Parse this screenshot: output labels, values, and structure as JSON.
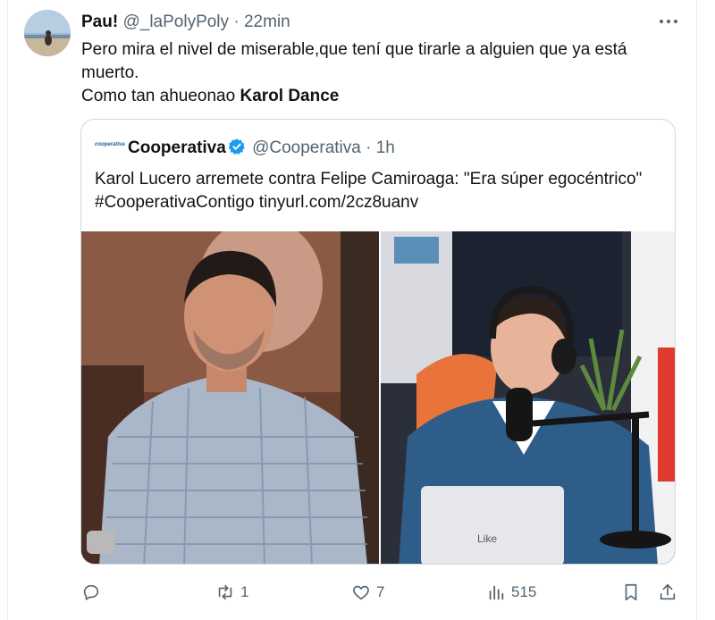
{
  "tweet": {
    "display_name": "Pau!",
    "handle": "@_laPolyPoly",
    "separator": "·",
    "time": "22min",
    "text_line1": "Pero mira el nivel de miserable,que tení que tirarle a alguien que ya está muerto.",
    "text_line2_prefix": "Como tan ahueonao ",
    "text_line2_bold": "Karol Dance"
  },
  "quote": {
    "logo_text": "cooperativa",
    "display_name": "Cooperativa",
    "handle": "@Cooperativa",
    "separator": "·",
    "time": "1h",
    "text_line1": "Karol Lucero arremete contra Felipe Camiroaga: \"Era súper egocéntrico\"",
    "text_line2": "#CooperativaContigo tinyurl.com/2cz8uanv",
    "photo_right_logo": "Like"
  },
  "actions": {
    "reply_count": "",
    "retweet_count": "1",
    "like_count": "7",
    "views_count": "515"
  },
  "colors": {
    "verified_blue": "#1d9bf0",
    "text_primary": "#0f1419",
    "text_secondary": "#536471",
    "border": "#cfd9de"
  }
}
